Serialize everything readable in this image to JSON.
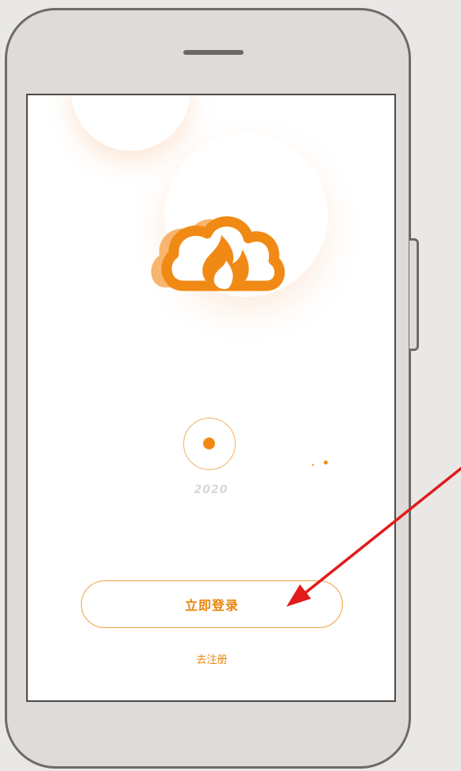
{
  "splash": {
    "year": "2020"
  },
  "actions": {
    "login_label": "立即登录",
    "register_label": "去注册"
  },
  "colors": {
    "accent": "#f08a15",
    "accent_light": "#f6ad5f",
    "annotation_arrow": "#e11b1b"
  },
  "icons": {
    "logo": "cloud-flame-logo",
    "indicator": "target-circle-icon"
  }
}
